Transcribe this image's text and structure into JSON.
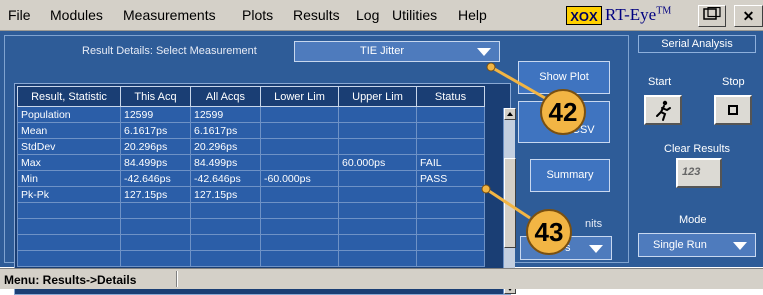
{
  "menubar": {
    "items": [
      "File",
      "Modules",
      "Measurements",
      "Plots",
      "Results",
      "Log",
      "Utilities",
      "Help"
    ],
    "logo_box": "XOX",
    "logo_text": "RT-Eye",
    "logo_tm": "TM"
  },
  "results": {
    "select_label": "Result Details: Select Measurement",
    "selected_measurement": "TIE Jitter",
    "columns": [
      "Result, Statistic",
      "This Acq",
      "All Acqs",
      "Lower Lim",
      "Upper Lim",
      "Status"
    ],
    "rows": [
      [
        "Population",
        "12599",
        "12599",
        "",
        "",
        ""
      ],
      [
        "Mean",
        "6.1617ps",
        "6.1617ps",
        "",
        "",
        ""
      ],
      [
        "StdDev",
        "20.296ps",
        "20.296ps",
        "",
        "",
        ""
      ],
      [
        "Max",
        "84.499ps",
        "84.499ps",
        "",
        "60.000ps",
        "FAIL"
      ],
      [
        "Min",
        "-42.646ps",
        "-42.646ps",
        "-60.000ps",
        "",
        "PASS"
      ],
      [
        "Pk-Pk",
        "127.15ps",
        "127.15ps",
        "",
        "",
        ""
      ],
      [
        "",
        "",
        "",
        "",
        "",
        ""
      ],
      [
        "",
        "",
        "",
        "",
        "",
        ""
      ],
      [
        "",
        "",
        "",
        "",
        "",
        ""
      ],
      [
        "",
        "",
        "",
        "",
        "",
        ""
      ]
    ]
  },
  "buttons": {
    "show_plot": "Show Plot",
    "export_top": "t",
    "export_bottom": "To CSV",
    "summary": "Summary",
    "units_label": "nits",
    "units_value": "s"
  },
  "serial_panel": {
    "title": "Serial Analysis",
    "start_label": "Start",
    "stop_label": "Stop",
    "clear_label": "Clear Results",
    "clear_icon_text": "123",
    "mode_label": "Mode",
    "mode_value": "Single Run"
  },
  "callouts": [
    "42",
    "43"
  ],
  "statusbar": {
    "text": "Menu: Results->Details"
  },
  "colors": {
    "panel_bg": "#2e5c98",
    "cell_bg": "#2b5ea8",
    "callout": "#f2b544"
  }
}
